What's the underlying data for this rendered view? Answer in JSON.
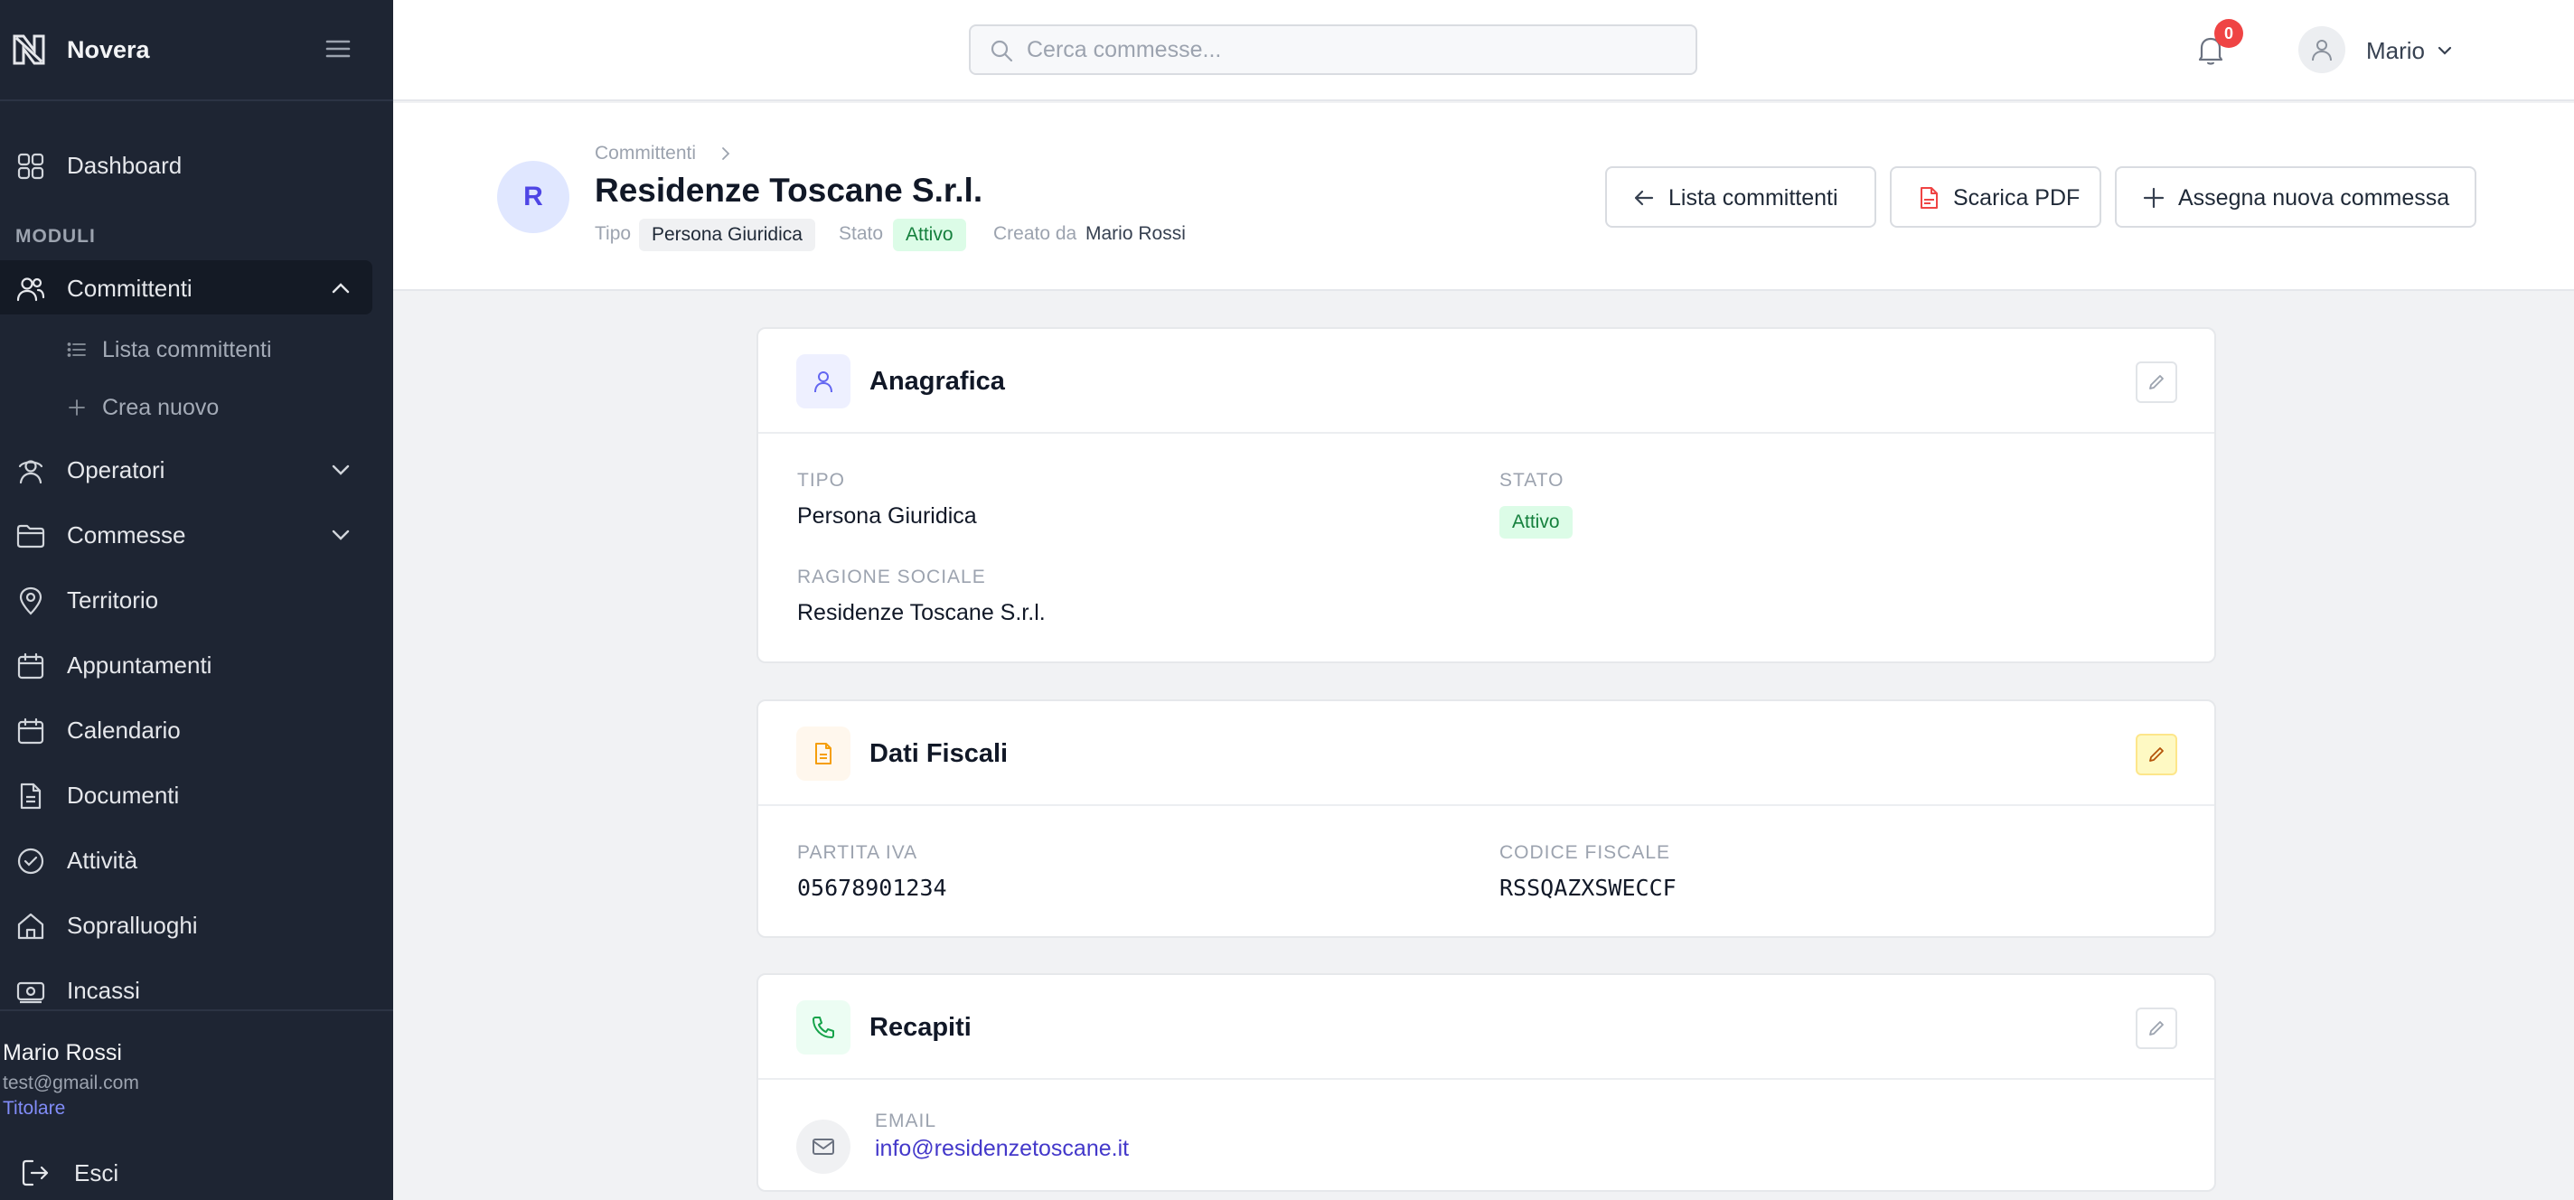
{
  "brand": {
    "name": "Novera"
  },
  "sidebar": {
    "section_label": "MODULI",
    "items": [
      {
        "key": "dashboard",
        "label": "Dashboard"
      },
      {
        "key": "committenti",
        "label": "Committenti"
      },
      {
        "key": "operatori",
        "label": "Operatori"
      },
      {
        "key": "commesse",
        "label": "Commesse"
      },
      {
        "key": "territorio",
        "label": "Territorio"
      },
      {
        "key": "appuntamenti",
        "label": "Appuntamenti"
      },
      {
        "key": "calendario",
        "label": "Calendario"
      },
      {
        "key": "documenti",
        "label": "Documenti"
      },
      {
        "key": "attivita",
        "label": "Attività"
      },
      {
        "key": "sopralluoghi",
        "label": "Sopralluoghi"
      },
      {
        "key": "incassi",
        "label": "Incassi"
      }
    ],
    "subitems": [
      {
        "label": "Lista committenti"
      },
      {
        "label": "Crea nuovo"
      }
    ],
    "user": {
      "name": "Mario Rossi",
      "email": "test@gmail.com",
      "role": "Titolare"
    },
    "logout_label": "Esci"
  },
  "topbar": {
    "search_placeholder": "Cerca commesse...",
    "notifications_count": "0",
    "profile_name": "Mario"
  },
  "header": {
    "avatar_initial": "R",
    "breadcrumb": "Committenti",
    "title": "Residenze Toscane S.r.l.",
    "tipo_label": "Tipo",
    "tipo_value": "Persona Giuridica",
    "stato_label": "Stato",
    "stato_value": "Attivo",
    "creato_label": "Creato da",
    "creato_value": "Mario Rossi",
    "buttons": {
      "list": "Lista committenti",
      "pdf": "Scarica PDF",
      "assign": "Assegna nuova commessa"
    }
  },
  "anagrafica": {
    "title": "Anagrafica",
    "tipo_label": "TIPO",
    "tipo_value": "Persona Giuridica",
    "stato_label": "STATO",
    "stato_value": "Attivo",
    "ragione_label": "RAGIONE SOCIALE",
    "ragione_value": "Residenze Toscane S.r.l."
  },
  "fiscali": {
    "title": "Dati Fiscali",
    "piva_label": "PARTITA IVA",
    "piva_value": "05678901234",
    "cf_label": "CODICE FISCALE",
    "cf_value": "RSSQAZXSWECCF"
  },
  "recapiti": {
    "title": "Recapiti",
    "email_label": "EMAIL",
    "email_value": "info@residenzetoscane.it"
  },
  "colors": {
    "sidebar_bg": "#1e2533",
    "accent": "#4f46e5",
    "success_bg": "#dcfce7",
    "success_text": "#15803d",
    "danger": "#ef4444"
  }
}
